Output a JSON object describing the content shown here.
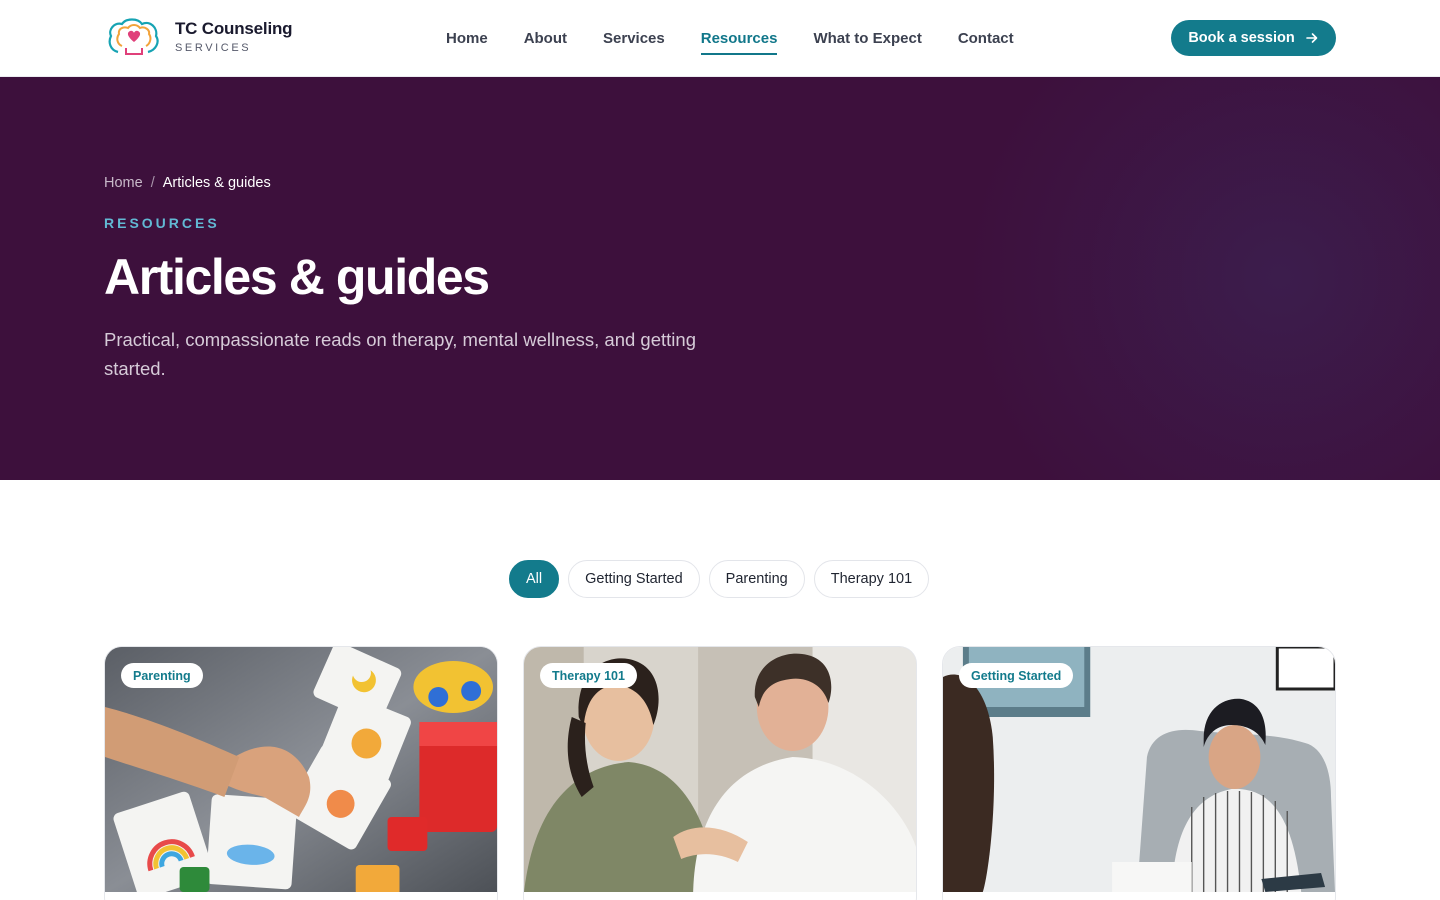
{
  "header": {
    "logo_title": "TC Counseling",
    "logo_subtitle": "SERVICES",
    "nav": [
      {
        "label": "Home",
        "active": false
      },
      {
        "label": "About",
        "active": false
      },
      {
        "label": "Services",
        "active": false
      },
      {
        "label": "Resources",
        "active": true
      },
      {
        "label": "What to Expect",
        "active": false
      },
      {
        "label": "Contact",
        "active": false
      }
    ],
    "cta_label": "Book a session",
    "cta_icon": "arrow-right-icon"
  },
  "hero": {
    "breadcrumb": {
      "home": "Home",
      "separator": "/",
      "current": "Articles & guides"
    },
    "eyebrow": "RESOURCES",
    "title": "Articles & guides",
    "description": "Practical, compassionate reads on therapy, mental wellness, and getting started."
  },
  "filters": [
    {
      "label": "All",
      "active": true
    },
    {
      "label": "Getting Started",
      "active": false
    },
    {
      "label": "Parenting",
      "active": false
    },
    {
      "label": "Therapy 101",
      "active": false
    }
  ],
  "cards": [
    {
      "tag": "Parenting",
      "image": "child-playing-emotion-cards-photo"
    },
    {
      "tag": "Therapy 101",
      "image": "couple-sitting-together-photo"
    },
    {
      "tag": "Getting Started",
      "image": "therapist-in-session-photo"
    }
  ],
  "colors": {
    "brand_teal": "#137b8c",
    "hero_bg": "#3d103c",
    "eyebrow": "#62b9d4"
  }
}
